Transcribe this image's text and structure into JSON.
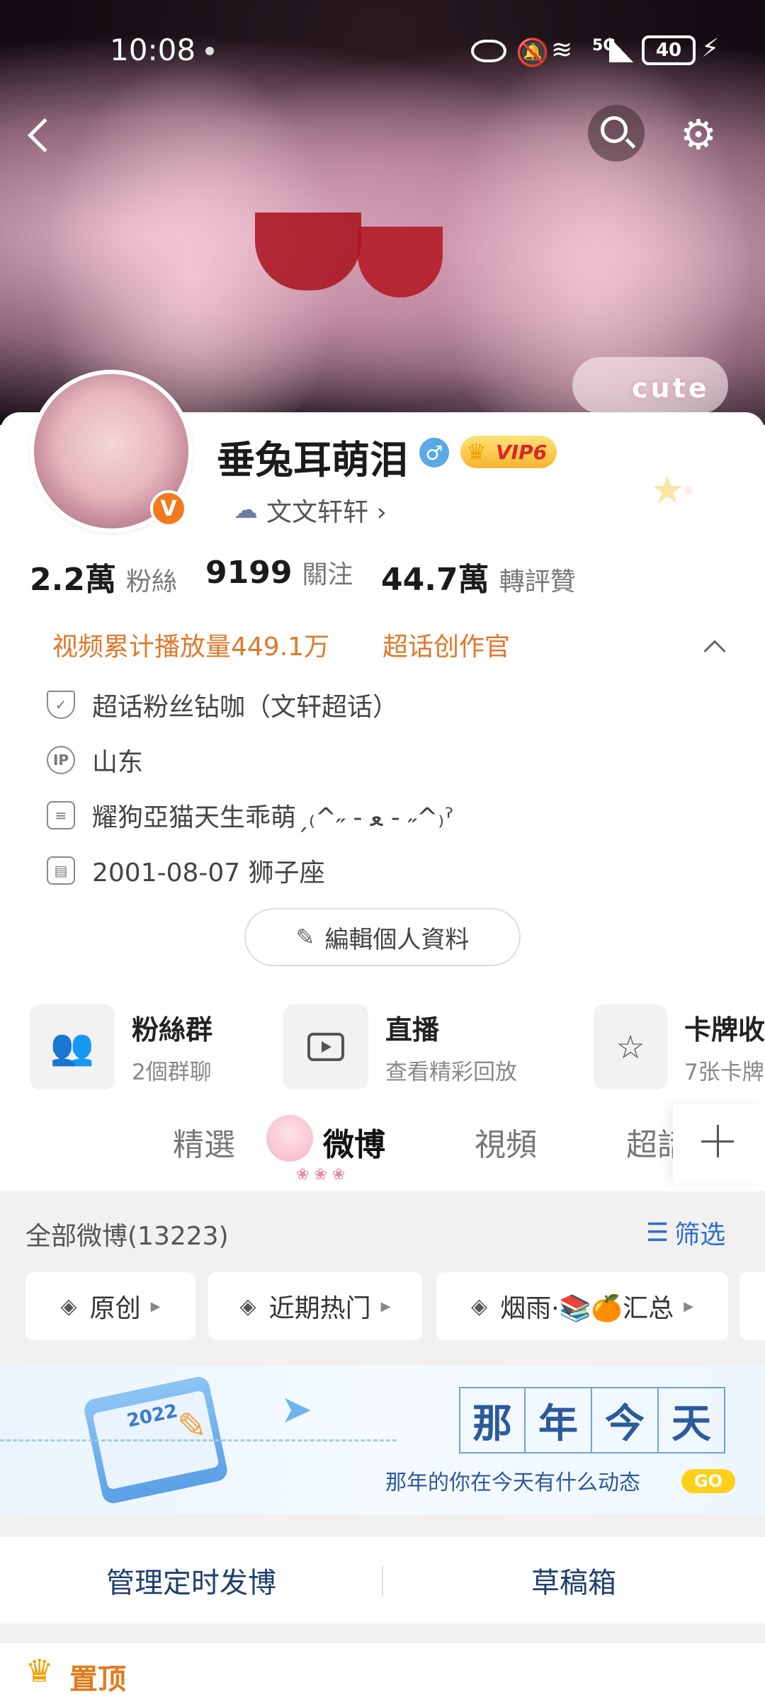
{
  "status_bar": {
    "time": "10:08",
    "network": "5G",
    "battery": "40"
  },
  "nav": {
    "back_icon": "chevron-left-icon",
    "search_icon": "search-icon",
    "settings_icon": "gear-icon"
  },
  "banner": {
    "sticker_text": "cute"
  },
  "profile": {
    "name": "垂兔耳萌泪",
    "vip_label": "VIP6",
    "topic_link": "文文轩轩 ›",
    "v_badge": "V"
  },
  "stats": [
    {
      "value": "2.2萬",
      "label": "粉絲"
    },
    {
      "value": "9199",
      "label": "關注"
    },
    {
      "value": "44.7萬",
      "label": "轉評贊"
    }
  ],
  "honors": {
    "play_count": "视频累计播放量449.1万",
    "creator_title": "超话创作官"
  },
  "info_rows": [
    {
      "icon": "shield-icon",
      "text": "超话粉丝钻咖（文轩超话）"
    },
    {
      "icon": "ip-icon",
      "text": "山东"
    },
    {
      "icon": "document-icon",
      "text": "耀狗亞猫天生乖萌ˏ₍^˶ - ﻌ - ˶^₎ˀ"
    },
    {
      "icon": "calendar-icon",
      "text": "2001-08-07 狮子座"
    }
  ],
  "edit_profile_label": "編輯個人資料",
  "features": [
    {
      "title": "粉絲群",
      "subtitle": "2個群聊",
      "icon": "group-icon"
    },
    {
      "title": "直播",
      "subtitle": "查看精彩回放",
      "icon": "tv-icon"
    },
    {
      "title": "卡牌收",
      "subtitle": "7张卡牌",
      "icon": "card-icon"
    }
  ],
  "tabs": [
    "精選",
    "微博",
    "視頻",
    "超話"
  ],
  "active_tab": "微博",
  "feed": {
    "all_posts": "全部微博(13223)",
    "filter_label": "筛选",
    "chips": [
      "原创",
      "近期热门",
      "烟雨·📚🍊汇总"
    ]
  },
  "memory_banner": {
    "year": "2022",
    "chars": [
      "那",
      "年",
      "今",
      "天"
    ],
    "subtitle": "那年的你在今天有什么动态",
    "go_label": "GO"
  },
  "actions": {
    "scheduled": "管理定时发博",
    "drafts": "草稿箱"
  },
  "pinned_label": "置顶"
}
